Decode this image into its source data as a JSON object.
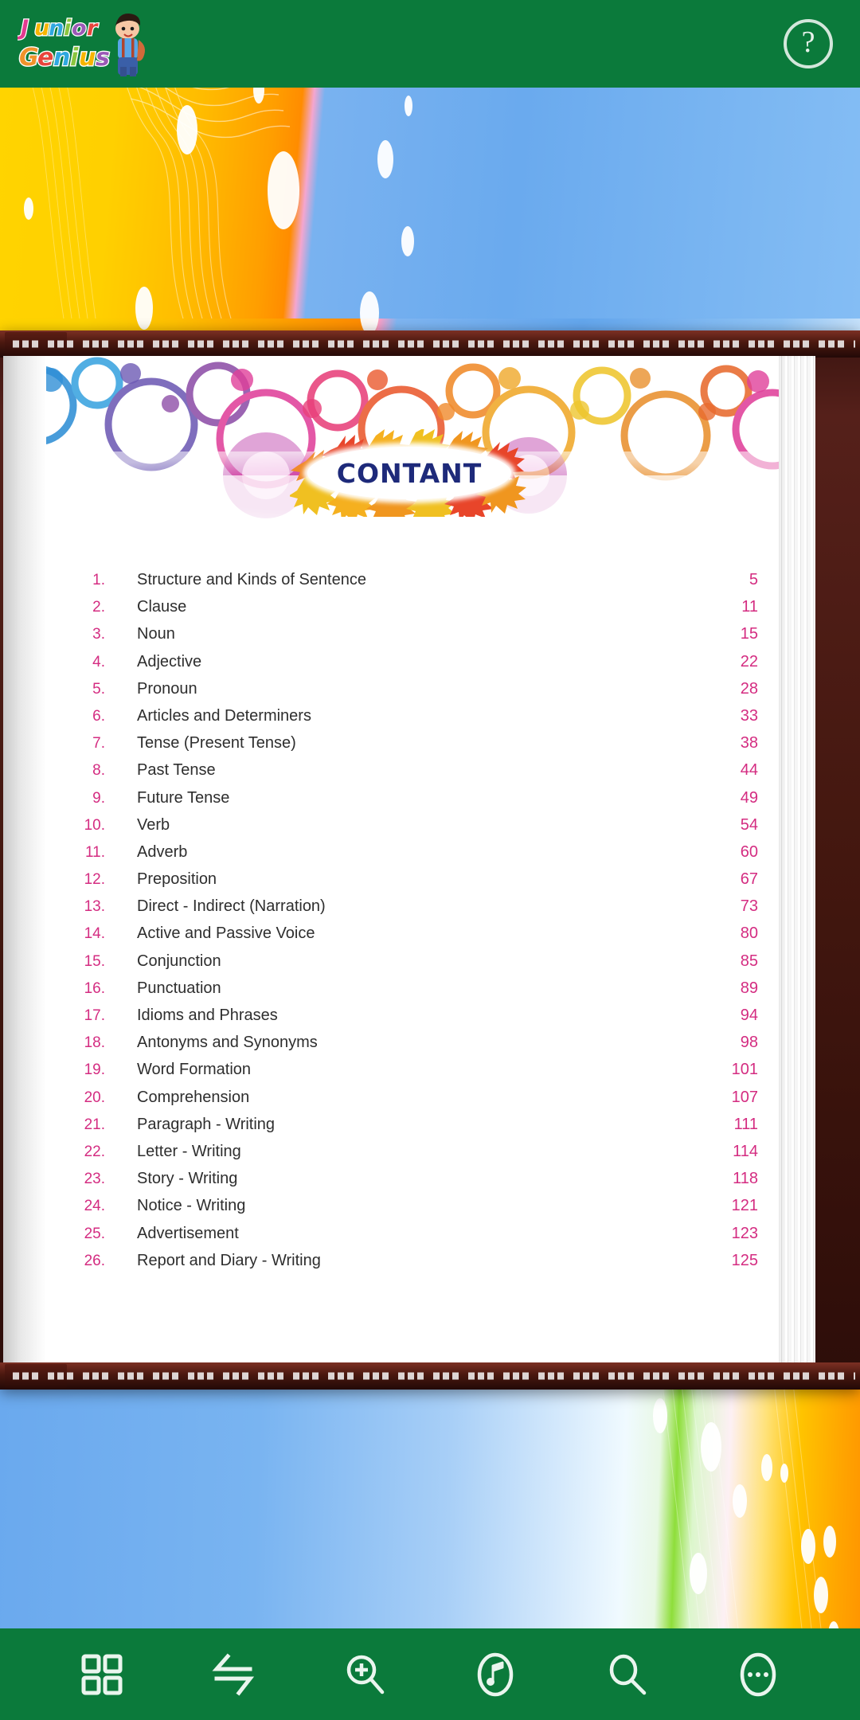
{
  "app": {
    "title": "Junior Genius",
    "logo_line1": "Junior",
    "logo_line2": "Genius",
    "brand_green": "#0b7a3b",
    "accent_pink": "#d42c81",
    "title_navy": "#1e2a7a"
  },
  "header": {
    "help_label": "?",
    "help_name": "help-button"
  },
  "book": {
    "title": "CONTANT",
    "contents": [
      {
        "num": "1.",
        "title": "Structure and Kinds of Sentence",
        "page": "5"
      },
      {
        "num": "2.",
        "title": "Clause",
        "page": "11"
      },
      {
        "num": "3.",
        "title": "Noun",
        "page": "15"
      },
      {
        "num": "4.",
        "title": "Adjective",
        "page": "22"
      },
      {
        "num": "5.",
        "title": "Pronoun",
        "page": "28"
      },
      {
        "num": "6.",
        "title": "Articles and Determiners",
        "page": "33"
      },
      {
        "num": "7.",
        "title": "Tense (Present Tense)",
        "page": "38"
      },
      {
        "num": "8.",
        "title": "Past Tense",
        "page": "44"
      },
      {
        "num": "9.",
        "title": "Future Tense",
        "page": "49"
      },
      {
        "num": "10.",
        "title": "Verb",
        "page": "54"
      },
      {
        "num": "11.",
        "title": "Adverb",
        "page": "60"
      },
      {
        "num": "12.",
        "title": "Preposition",
        "page": "67"
      },
      {
        "num": "13.",
        "title": "Direct - Indirect (Narration)",
        "page": "73"
      },
      {
        "num": "14.",
        "title": "Active and Passive Voice",
        "page": "80"
      },
      {
        "num": "15.",
        "title": "Conjunction",
        "page": "85"
      },
      {
        "num": "16.",
        "title": "Punctuation",
        "page": "89"
      },
      {
        "num": "17.",
        "title": "Idioms and Phrases",
        "page": "94"
      },
      {
        "num": "18.",
        "title": "Antonyms and Synonyms",
        "page": "98"
      },
      {
        "num": "19.",
        "title": "Word Formation",
        "page": "101"
      },
      {
        "num": "20.",
        "title": "Comprehension",
        "page": "107"
      },
      {
        "num": "21.",
        "title": "Paragraph - Writing",
        "page": "111"
      },
      {
        "num": "22.",
        "title": "Letter - Writing",
        "page": "114"
      },
      {
        "num": "23.",
        "title": "Story - Writing",
        "page": "118"
      },
      {
        "num": "24.",
        "title": "Notice - Writing",
        "page": "121"
      },
      {
        "num": "25.",
        "title": "Advertisement",
        "page": "123"
      },
      {
        "num": "26.",
        "title": "Report and Diary - Writing",
        "page": "125"
      }
    ]
  },
  "toolbar": {
    "items": [
      {
        "icon": "grid-icon",
        "label": "Thumbnails"
      },
      {
        "icon": "page-flip-icon",
        "label": "Flip"
      },
      {
        "icon": "zoom-in-icon",
        "label": "Zoom In"
      },
      {
        "icon": "music-note-icon",
        "label": "Audio"
      },
      {
        "icon": "search-icon",
        "label": "Search"
      },
      {
        "icon": "more-options-icon",
        "label": "More"
      }
    ]
  }
}
